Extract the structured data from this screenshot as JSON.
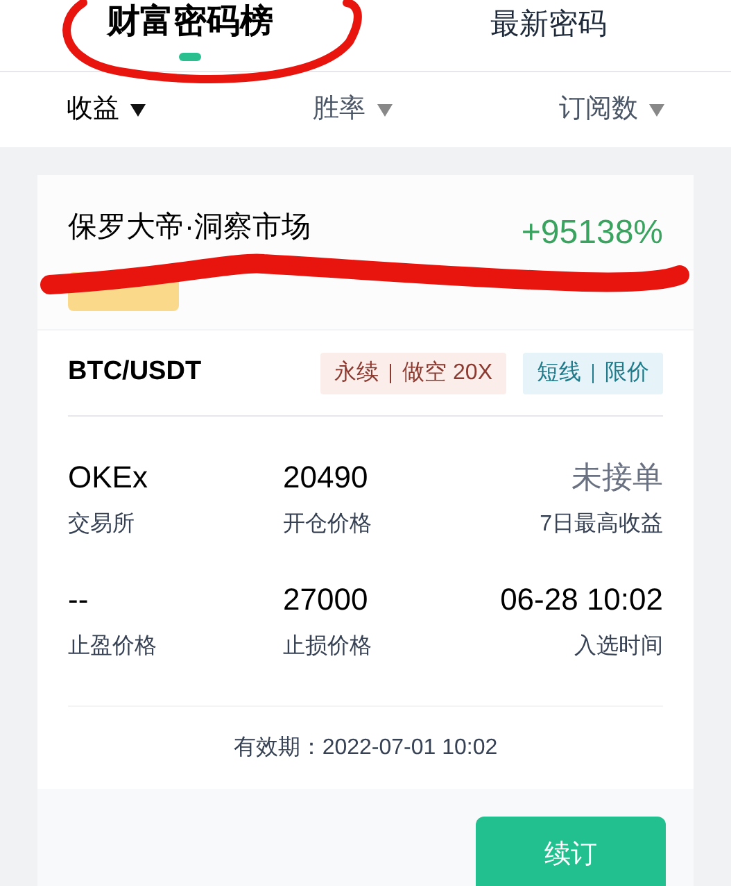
{
  "tabs": [
    {
      "label": "财富密码榜",
      "selected": true
    },
    {
      "label": "最新密码",
      "selected": false
    }
  ],
  "sort_options": [
    {
      "label": "收益",
      "selected": true
    },
    {
      "label": "胜率",
      "selected": false
    },
    {
      "label": "订阅数",
      "selected": false
    }
  ],
  "card": {
    "name": "保罗大帝·洞察市场",
    "return": "+95138%",
    "badge": {
      "kind": "hidden"
    },
    "pair": "BTC/USDT",
    "tags": [
      {
        "parts": [
          "永续",
          "做空 20X"
        ],
        "color": "#fbeeea"
      },
      {
        "parts": [
          "短线",
          "限价"
        ],
        "color": "#e6f3f8"
      }
    ],
    "stats": [
      {
        "value": "OKEx",
        "label": "交易所",
        "muted": false
      },
      {
        "value": "20490",
        "label": "开仓价格",
        "muted": false
      },
      {
        "value": "未接单",
        "label": "7日最高收益",
        "muted": true
      },
      {
        "value": "--",
        "label": "止盈价格",
        "muted": false
      },
      {
        "value": "27000",
        "label": "止损价格",
        "muted": false
      },
      {
        "value": "06-28 10:02",
        "label": "入选时间",
        "muted": false
      }
    ],
    "validity": "有效期：2022-07-01 10:02",
    "button": "续订"
  },
  "annotations": [
    {
      "kind": "circle"
    },
    {
      "kind": "scribble"
    }
  ]
}
